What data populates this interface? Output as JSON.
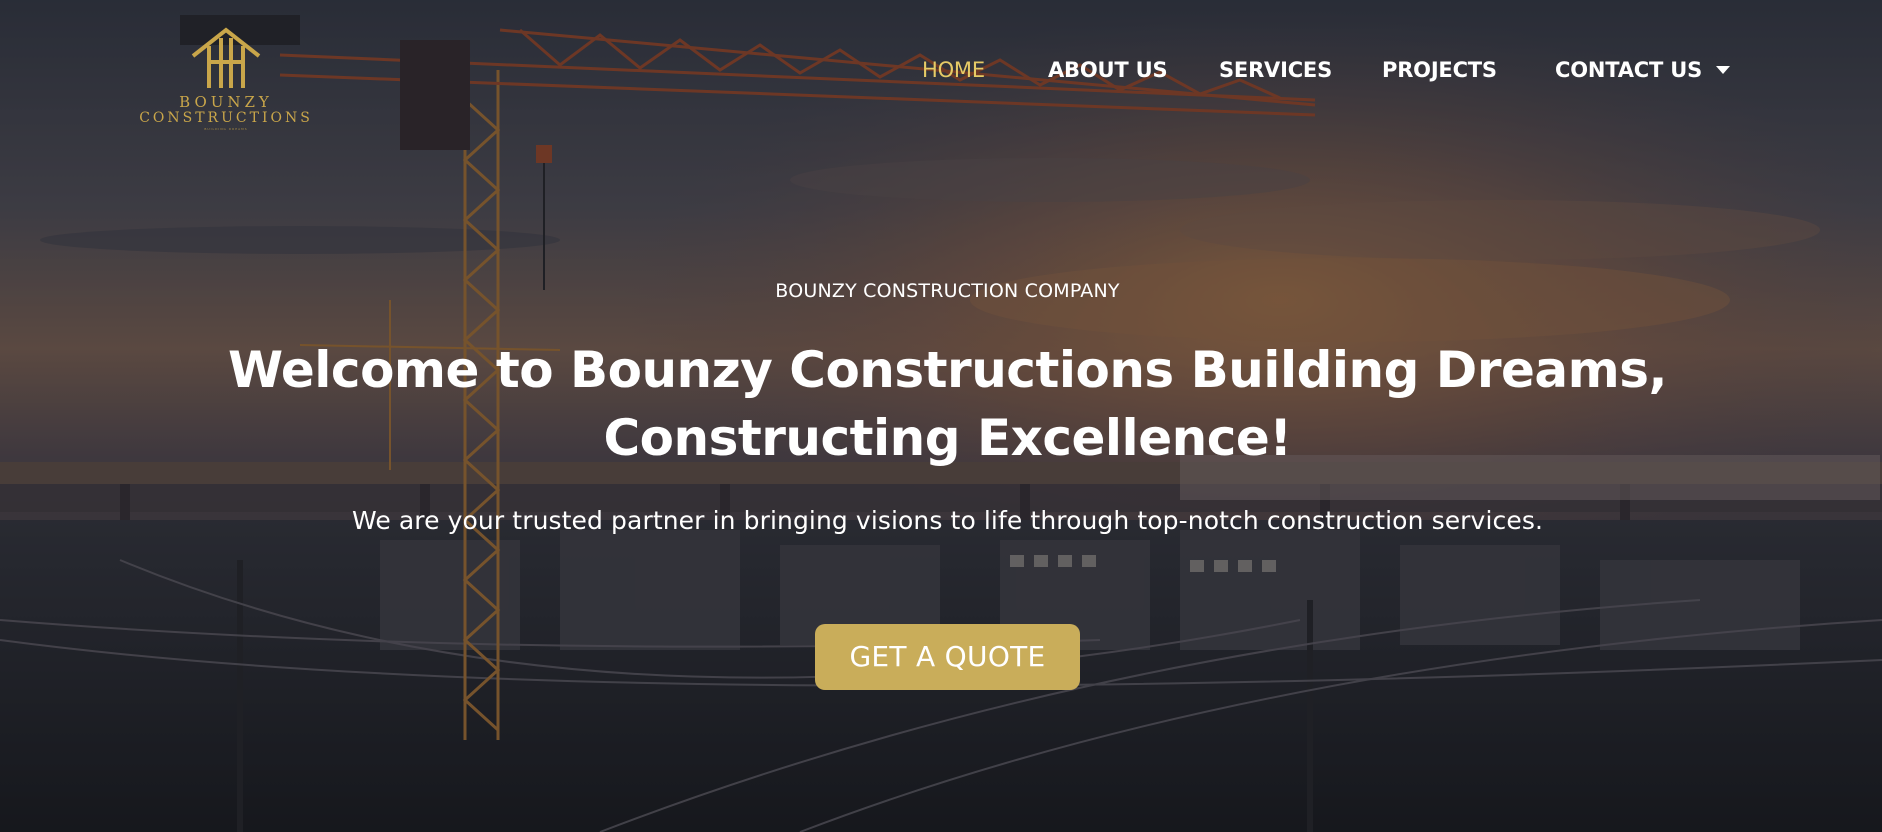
{
  "brand": {
    "name": "BOUNZY",
    "subtitle": "CONSTRUCTIONS",
    "tagline": "BUILDING DREAMS",
    "logo_icon": "house-roof-logo-icon",
    "accent_color": "#c9ad5a"
  },
  "nav": {
    "items": [
      {
        "label": "HOME",
        "active": true
      },
      {
        "label": "ABOUT US",
        "active": false
      },
      {
        "label": "SERVICES",
        "active": false
      },
      {
        "label": "PROJECTS",
        "active": false
      },
      {
        "label": "CONTACT US",
        "active": false,
        "has_dropdown": true
      }
    ],
    "active_color": "#e6cb66",
    "dropdown_icon": "caret-down-icon"
  },
  "hero": {
    "eyebrow": "BOUNZY CONSTRUCTION COMPANY",
    "headline_line1": "Welcome to Bounzy Constructions Building Dreams,",
    "headline_line2": "Constructing Excellence!",
    "subtext": "We are your trusted partner in bringing visions to life through top-notch construction services.",
    "cta_label": "GET A QUOTE",
    "background": "tower-crane-city-sunset-photo"
  }
}
